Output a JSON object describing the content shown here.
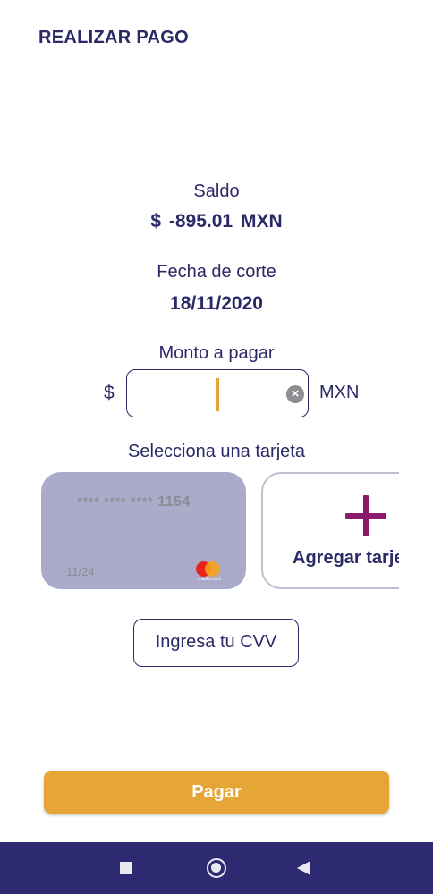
{
  "header": {
    "title": "REALIZAR PAGO"
  },
  "balance": {
    "label": "Saldo",
    "value": "$ -895.01 MXN"
  },
  "cutoff": {
    "label": "Fecha de corte",
    "value": "18/11/2020"
  },
  "amount": {
    "label": "Monto a pagar",
    "currency_symbol": "$",
    "value": "",
    "currency_code": "MXN"
  },
  "cards": {
    "label": "Selecciona una tarjeta",
    "saved": [
      {
        "number_masked": "**** **** ****",
        "last4": "1154",
        "expiry": "11/24",
        "brand": "mastercard",
        "brand_text": "mastercard"
      }
    ],
    "add_label": "Agregar tarjeta"
  },
  "cvv_button": {
    "label": "Ingresa tu CVV"
  },
  "pay_button": {
    "label": "Pagar"
  },
  "colors": {
    "primary": "#2b2966",
    "accent": "#e6a537",
    "card": "#a9abc9",
    "plus": "#8c1a6c",
    "nav": "#2d2a72"
  },
  "navbar": {
    "icons": [
      "recent-apps-icon",
      "home-icon",
      "back-icon"
    ]
  }
}
